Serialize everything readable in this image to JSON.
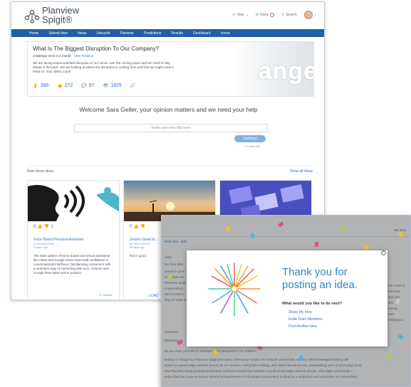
{
  "back_window": {
    "brand_line1": "Planview",
    "brand_line2": "Spigit®",
    "header_links": [
      "Vote",
      "Inbox",
      "Search"
    ],
    "nav": [
      "Home",
      "Submit Idea",
      "Ideas",
      "Lifecycle",
      "Pairwise",
      "Predictions",
      "Results",
      "Dashboard",
      "Invest"
    ],
    "question": {
      "title": "What Is The Biggest Disruption To Our Company?",
      "challenge": "Challenge ends in a month",
      "timeline_link": "View Timeline",
      "description": "We are facing unprecedented disruption in our sector over the coming years and we need to stay ahead of the pack. We are looking at where the disruption is coming from and how we might meet it head on. Your ideas count!",
      "photo_text": "ange",
      "stats": [
        "398",
        "272",
        "67",
        "1925"
      ]
    },
    "welcome": "Welcome Sara Geller, your opinion matters and we need your help",
    "idea_placeholder": "Enter your idea title here",
    "continue_label": "Continue",
    "small_link": "a month left",
    "rate_label": "Rate these ideas",
    "show_all": "Show all ideas",
    "cards": [
      {
        "votes_up": "0",
        "votes_down": "1",
        "title": "Voice Based Personal Assistant",
        "by": "by Kimberly Ruth",
        "when": "5 years ago",
        "desc": "The wide uptake of home based and virtual assistants like Alexa and Google Home have built confidence in conversational interfaces, familiarising consumers with a seamless way of interacting with tech. Amazon and Google have taken prime position...",
        "status": "Viewed",
        "progress": 0.55
      },
      {
        "votes_up": "0",
        "votes_down": "",
        "title": "Jesons Great Id...",
        "by": "by Steve Mclaren",
        "when": "35 days ago",
        "desc": "this is good",
        "status": "",
        "progress": 0.0
      },
      {
        "votes_up": "",
        "votes_down": "",
        "title": "",
        "by": "",
        "when": "",
        "desc": "",
        "status": "",
        "progress": 0.0
      }
    ],
    "load_more": "LOAD"
  },
  "front_window": {
    "tabs": [
      "Print Idea",
      "Edit"
    ],
    "my_view": "My View",
    "bg_text": [
      "ories",
      "ibe Your Idea",
      "posed to grow",
      "of devices wh",
      "Planview Spigit",
      "a specialized",
      "ders to earn s",
      "ling IoT edge ser",
      "Impacted",
      "Marketing, E",
      "do you think your idea is relevant to the disruption in our market?",
      "ectivity of Things is a Planview Spigit promoted, community hosted, IoT network connectivity service, which leverages existing cell",
      "works to expand edge network access for IoT devices. Using their existing, and initial internet access, participating users (community) insta",
      "and Planview Spigit provided proprietary software to build and maintain a multi-modal edge network access. This edge connectivity c",
      "subscribed as a pay-as-you-go service by businesses or individuals (consumers) looking for a ubiquitous and expansive IoT connectivity"
    ],
    "right_bg_text": [
      "ets in the lo",
      "hectivity",
      "and use",
      "sde",
      "munity",
      "eam",
      "ending mu"
    ]
  },
  "modal": {
    "close": "×",
    "thank_you": "Thank you for posting an idea.",
    "next_prompt": "What would you like to do next?",
    "options": [
      "Share My Idea",
      "Invite Team Members",
      "Post Another Idea"
    ]
  },
  "colors": {
    "nav_bar": "#1f5fa8",
    "link": "#2d73c4",
    "thank_you": "#2f86c8"
  }
}
